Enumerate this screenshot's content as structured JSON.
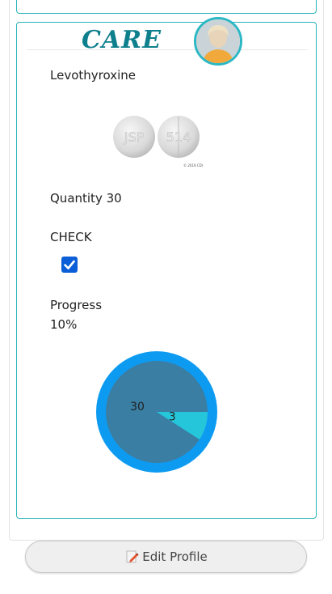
{
  "brand": {
    "name": "CARE"
  },
  "medication": {
    "name": "Levothyroxine",
    "pill_imprints": [
      "JSP",
      "514"
    ],
    "pill_caption": "© 2019 CDI",
    "quantity_label": "Quantity 30",
    "check_label": "CHECK",
    "check_checked": true,
    "progress_label": "Progress",
    "progress_value": "10%"
  },
  "chart_data": {
    "type": "pie",
    "slices": [
      {
        "label": "30",
        "value": 30,
        "color": "#3a7ea3"
      },
      {
        "label": "3",
        "value": 3,
        "color": "#26c6da"
      }
    ],
    "ring_color": "#0d9bf2"
  },
  "actions": {
    "edit_profile_label": "Edit Profile"
  }
}
